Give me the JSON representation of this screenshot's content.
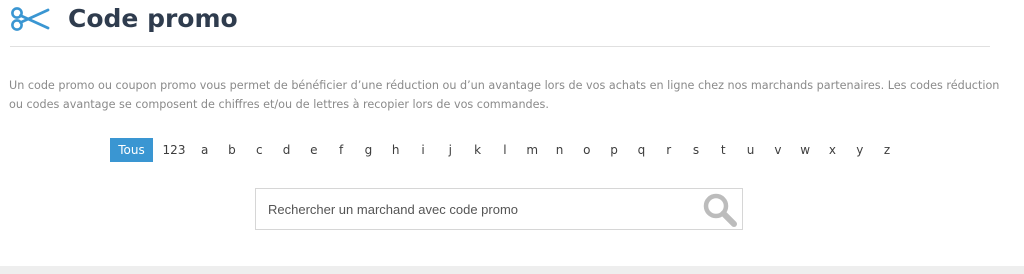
{
  "header": {
    "title": "Code promo",
    "icon": "scissors-icon",
    "accent_color": "#3a96d2"
  },
  "intro": {
    "text": "Un code promo ou coupon promo vous permet de bénéficier d’une réduction ou d’un avantage lors de vos achats en ligne chez nos marchands partenaires. Les codes réduction ou codes avantage se composent de chiffres et/ou de lettres à recopier lors de vos commandes."
  },
  "alphabet_filter": {
    "selected": "Tous",
    "items": [
      "Tous",
      "123",
      "a",
      "b",
      "c",
      "d",
      "e",
      "f",
      "g",
      "h",
      "i",
      "j",
      "k",
      "l",
      "m",
      "n",
      "o",
      "p",
      "q",
      "r",
      "s",
      "t",
      "u",
      "v",
      "w",
      "x",
      "y",
      "z"
    ]
  },
  "search": {
    "placeholder": "Rechercher un marchand avec code promo",
    "value": "",
    "icon": "search-icon"
  }
}
